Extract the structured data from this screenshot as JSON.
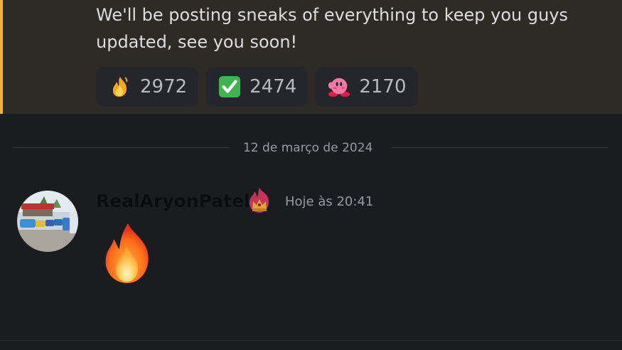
{
  "message_top": {
    "text": "We'll be posting sneaks of everything to keep you guys updated, see you soon!",
    "reactions": [
      {
        "icon": "fire-icon",
        "count": "2972"
      },
      {
        "icon": "check-mark-icon",
        "count": "2474"
      },
      {
        "icon": "kirby-icon",
        "count": "2170"
      }
    ]
  },
  "date_divider": "12 de março de 2024",
  "message": {
    "username": "RealAryonPatel",
    "timestamp": "Hoje às 20:41",
    "avatar_icon": "cars-photo-avatar",
    "badge_icon": "flaming-crown-icon",
    "content_emoji": "fire-emoji-icon"
  },
  "colors": {
    "highlight_bg": "#2e2b27",
    "highlight_bar": "#f0b232",
    "background": "#1b1c20",
    "reaction_bg": "#24262b"
  }
}
